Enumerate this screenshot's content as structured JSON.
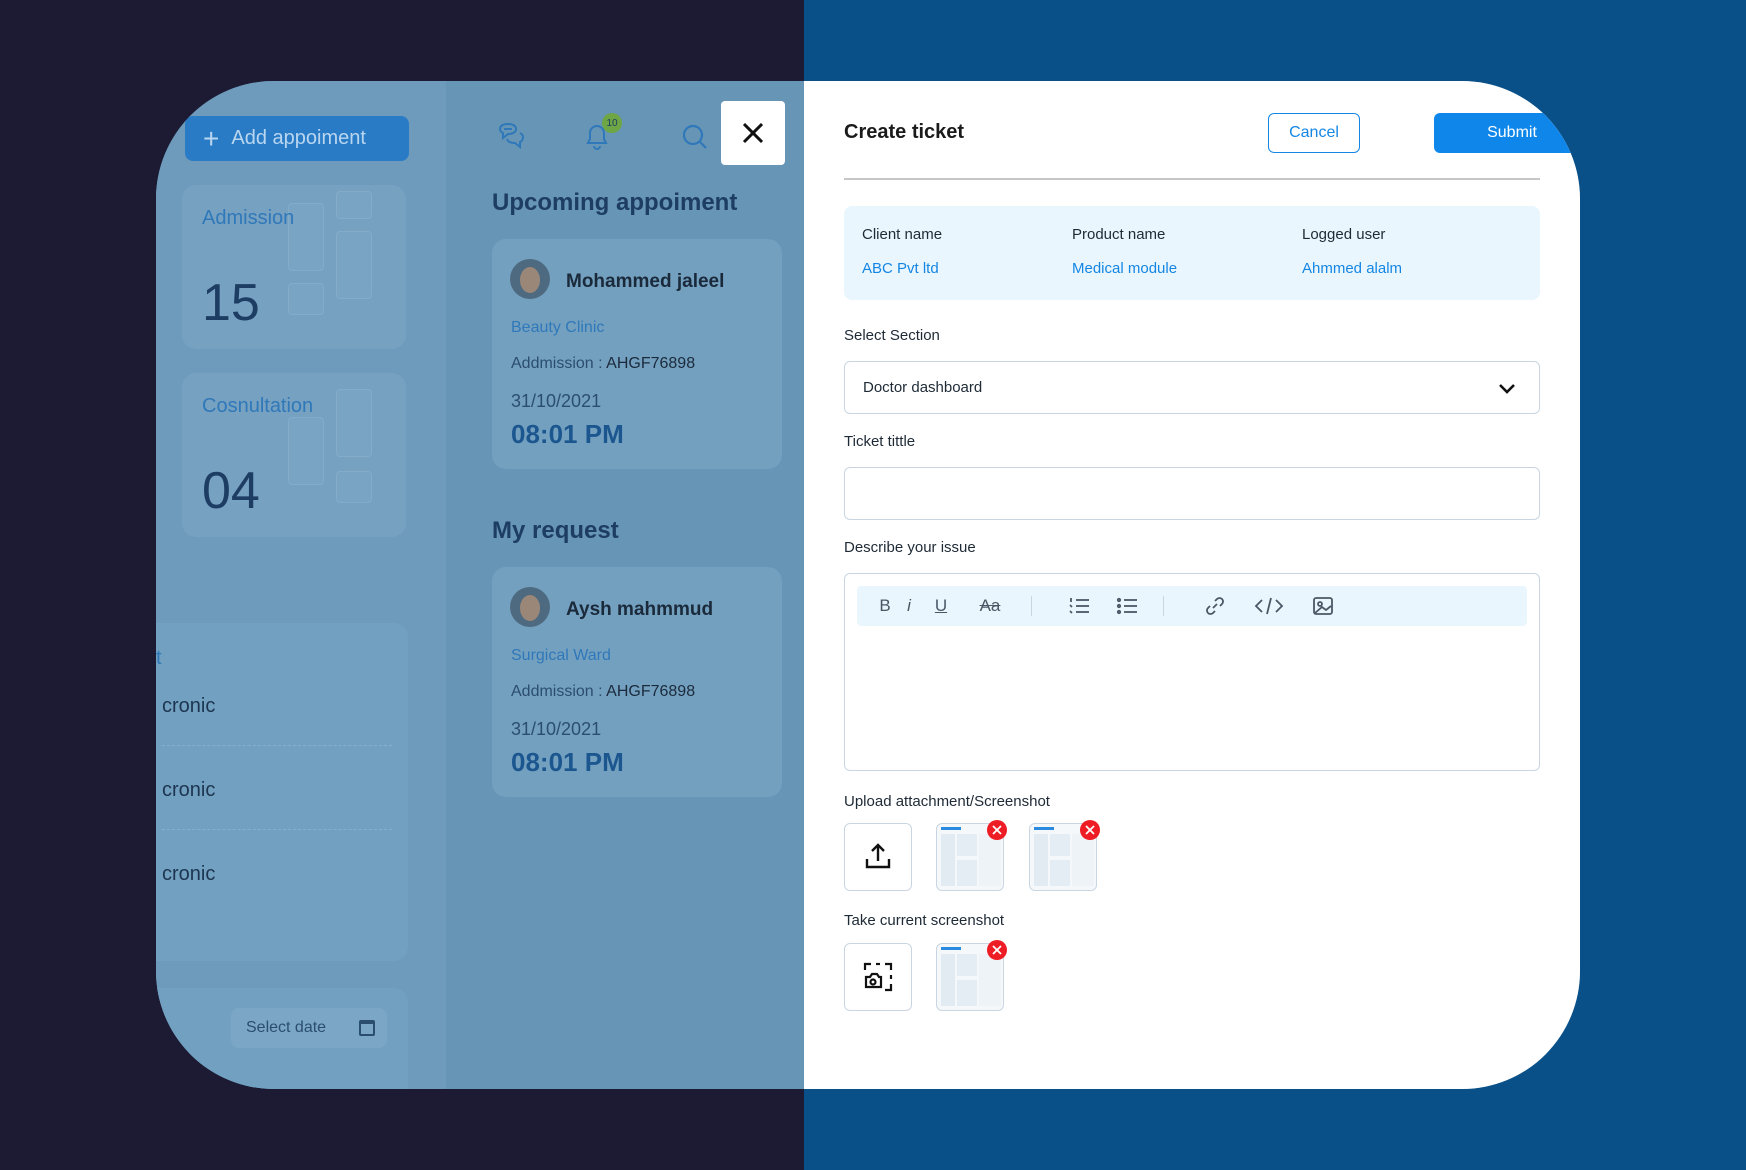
{
  "dashboard": {
    "add_button_label": "Add appoiment",
    "notification_count": "10",
    "stats": [
      {
        "label": "Admission",
        "value": "15"
      },
      {
        "label": "Cosnultation",
        "value": "04"
      }
    ],
    "list": {
      "header": "t",
      "rows": [
        "cronic",
        "cronic",
        "cronic"
      ]
    },
    "select_date_label": "Select date",
    "upcoming_title": "Upcoming appoiment",
    "my_request_title": "My request",
    "upcoming": {
      "name": "Mohammed jaleel",
      "department": "Beauty Clinic",
      "admission_label": "Addmission :",
      "admission_id": "AHGF76898",
      "date": "31/10/2021",
      "time": "08:01 PM"
    },
    "request": {
      "name": "Aysh mahmmud",
      "department": "Surgical Ward",
      "admission_label": "Addmission :",
      "admission_id": "AHGF76898",
      "date": "31/10/2021",
      "time": "08:01 PM"
    }
  },
  "ticket": {
    "title": "Create ticket",
    "cancel_label": "Cancel",
    "submit_label": "Submit",
    "info": {
      "client_label": "Client name",
      "client_value": "ABC Pvt ltd",
      "product_label": "Product name",
      "product_value": "Medical module",
      "user_label": "Logged user",
      "user_value": "Ahmmed alalm"
    },
    "section_label": "Select Section",
    "section_value": "Doctor dashboard",
    "title_label": "Ticket tittle",
    "title_value": "",
    "describe_label": "Describe your issue",
    "toolbar": {
      "bold": "B",
      "italic": "i",
      "underline": "U",
      "strike": "Aa"
    },
    "upload_label": "Upload attachment/Screenshot",
    "screenshot_label": "Take current screenshot"
  },
  "colors": {
    "accent": "#0e86ea",
    "remove": "#ee1c24",
    "overlay": "#6a96b7",
    "page_left": "#1c1b33",
    "page_right": "#0a5088"
  }
}
